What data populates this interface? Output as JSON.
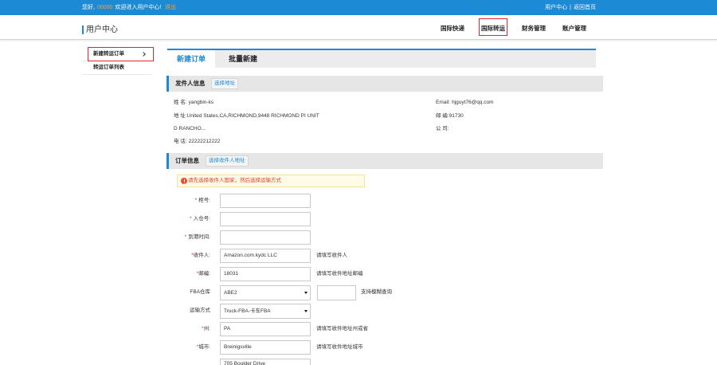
{
  "topbar": {
    "greeting_prefix": "您好,",
    "user_id": "00000",
    "greeting_suffix": "欢迎进入用户中心!",
    "logout": "退出",
    "user_center_link": "用户中心",
    "separator": "|",
    "home_link": "返回首页"
  },
  "header": {
    "title": "用户中心",
    "nav": [
      {
        "label": "国际快递",
        "active": false
      },
      {
        "label": "国际转运",
        "active": true
      },
      {
        "label": "财务管理",
        "active": false
      },
      {
        "label": "账户管理",
        "active": false
      }
    ]
  },
  "sidebar": {
    "items": [
      {
        "label": "新建转运订单",
        "active": true,
        "icon": "chevron-right-icon"
      },
      {
        "label": "转运订单列表",
        "active": false
      }
    ]
  },
  "tabs": [
    {
      "label": "新建订单",
      "active": true
    },
    {
      "label": "批量新建",
      "active": false
    }
  ],
  "sender": {
    "section_title": "发件人信息",
    "select_button": "选择地址",
    "name_label": "姓 名:",
    "name": "yangbin-ks",
    "address_label": "地 址:",
    "address": "United States,CA,RICHMOND,9448 RICHMOND PI UNIT D RANCHO...",
    "phone_label": "电 话:",
    "phone": "22222212222",
    "email_label": "Email:",
    "email": "hjguyt76@qq.com",
    "postcode_label": "邮 编:",
    "postcode": "91730",
    "company_label": "公 司:"
  },
  "order": {
    "section_title": "订单信息",
    "select_button": "选择收件人地址",
    "warning": "请先选择收件人国家，然后选择运输方式",
    "warning_icon": "warning-icon",
    "required_mark": "*",
    "fields": [
      {
        "label": "柜号:",
        "required": true,
        "value": ""
      },
      {
        "label": "入仓号:",
        "required": true,
        "value": ""
      },
      {
        "label": "到港时间:",
        "required": true,
        "value": ""
      },
      {
        "label": "收件人:",
        "required": true,
        "value": "Amazon.com.kydc LLC",
        "hint": "请填写收件人"
      },
      {
        "label": "邮编:",
        "required": true,
        "value": "18031",
        "hint": "请填写收件地址邮编"
      },
      {
        "label": "FBA仓库",
        "required": false,
        "value": "ABE2",
        "search_value": "",
        "hint": "支持模糊查询"
      },
      {
        "label": "运输方式",
        "required": false,
        "value": "Truck-FBA-卡车FBA"
      },
      {
        "label": "州:",
        "required": true,
        "value": "PA",
        "hint": "请填写收件地址州或省"
      },
      {
        "label": "城市:",
        "required": true,
        "value": "Breinigsville",
        "hint": "请填写收件地址城市"
      },
      {
        "value": "705 Boulder Drive"
      }
    ]
  },
  "colors": {
    "primary_blue": "#1c8ad4",
    "greeting_orange": "#f5a23a",
    "required_red": "#e3262d",
    "highlight_box_red": "#e3262d",
    "warning_text_red": "#e33b2b",
    "section_header_gray": "#e6e6e6"
  }
}
